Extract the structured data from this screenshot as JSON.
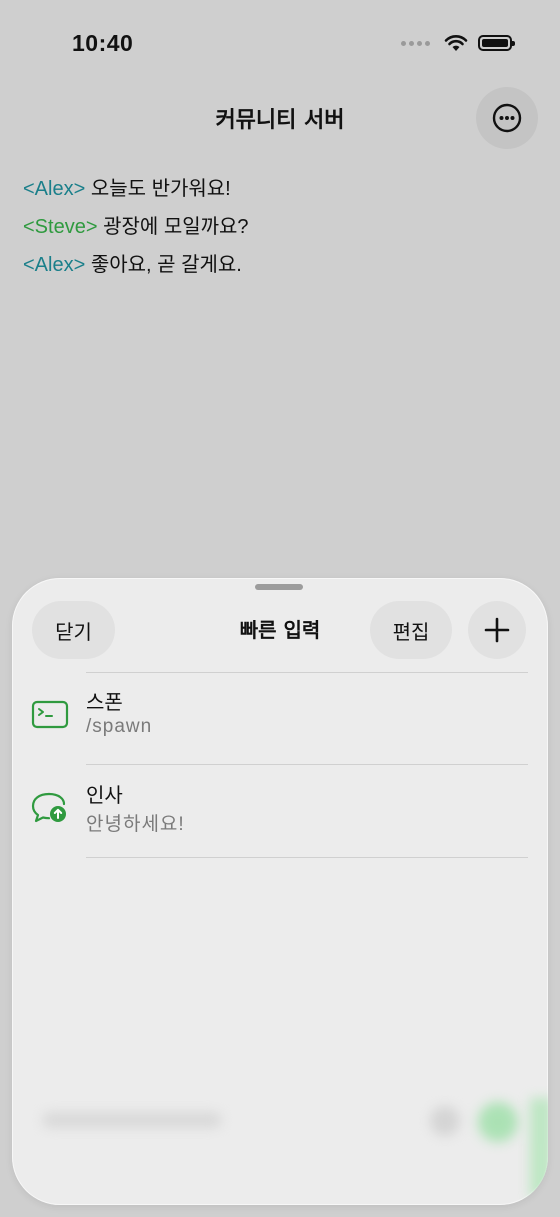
{
  "status_bar": {
    "time": "10:40"
  },
  "header": {
    "title": "커뮤니티 서버"
  },
  "messages": [
    {
      "name": "<Alex>",
      "text": " 오늘도 반가워요!"
    },
    {
      "name": "<Steve>",
      "text": " 광장에 모일까요?"
    },
    {
      "name": "<Alex>",
      "text": " 좋아요, 곧 갈게요."
    }
  ],
  "sheet": {
    "close_label": "닫기",
    "title": "빠른 입력",
    "edit_label": "편집",
    "items": [
      {
        "title": "스폰",
        "subtitle": "/spawn",
        "icon": "terminal-icon"
      },
      {
        "title": "인사",
        "subtitle": "안녕하세요!",
        "icon": "chat-send-icon"
      }
    ]
  },
  "colors": {
    "name_alex": "#1a7f8a",
    "name_steve": "#2f9a3f",
    "accent_green": "#2f9a3f"
  }
}
